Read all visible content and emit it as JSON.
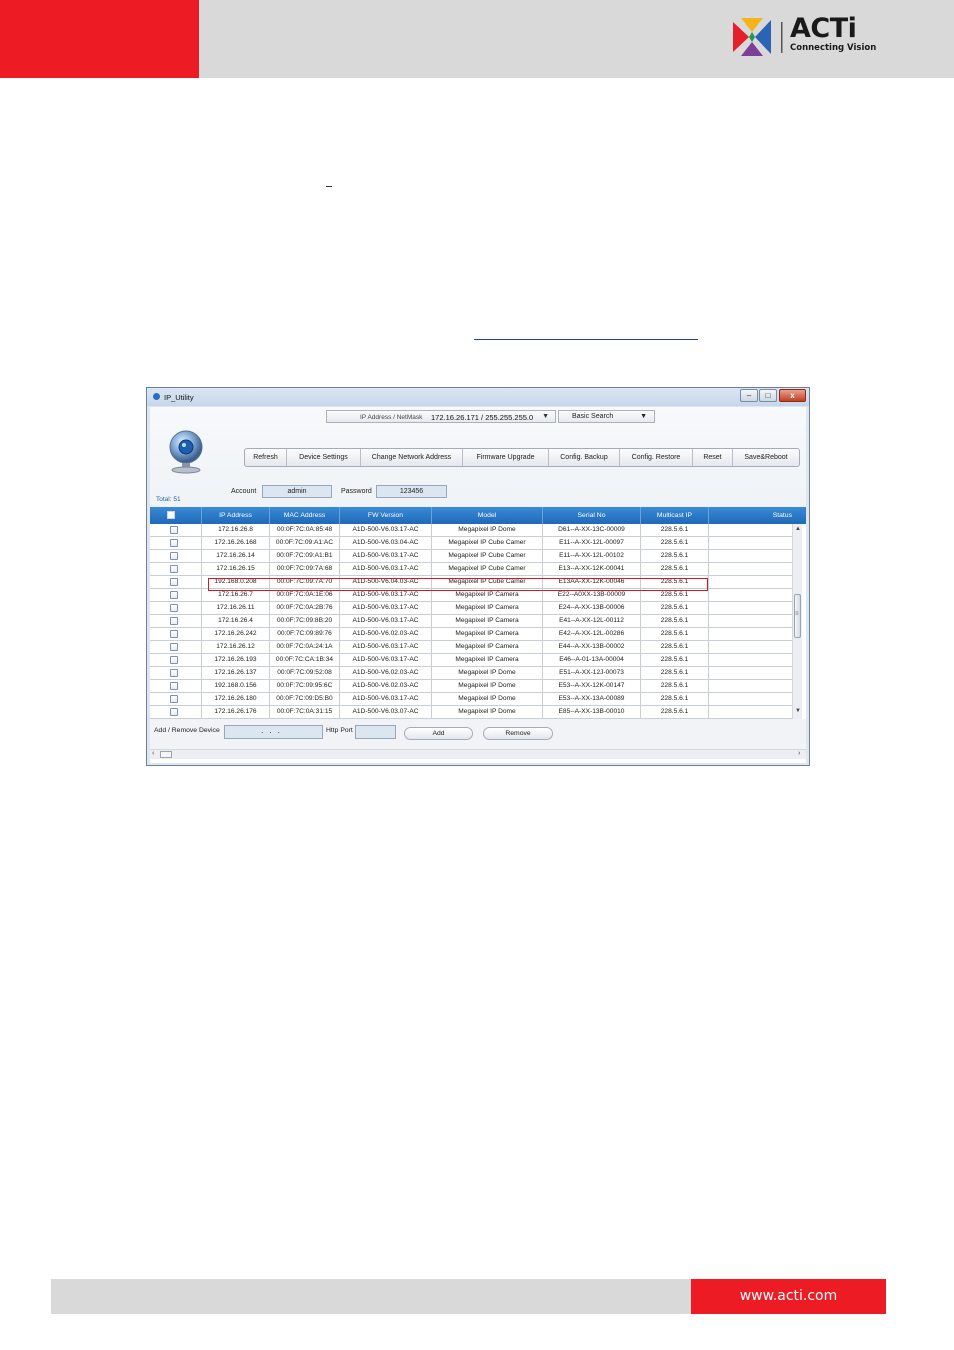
{
  "header": {
    "brand": "ACTi",
    "tagline": "Connecting Vision"
  },
  "footer": {
    "url": "www.acti.com"
  },
  "window": {
    "title": "IP_Utility",
    "minimize_label": "–",
    "maximize_label": "□",
    "close_label": "x",
    "ip_selector_label": "IP Address / NetMask",
    "ip_selector_value": "172.16.26.171 / 255.255.255.0",
    "search_mode": "Basic Search",
    "toolbar": [
      "Refresh",
      "Device Settings",
      "Change Network Address",
      "Firmware Upgrade",
      "Config. Backup",
      "Config. Restore",
      "Reset",
      "Save&Reboot"
    ],
    "account_label": "Account",
    "account_value": "admin",
    "password_label": "Password",
    "password_value": "123456",
    "total": "Total: 51",
    "columns": [
      "IP Address",
      "MAC Address",
      "FW Version",
      "Model",
      "Serial No",
      "Multicast IP",
      "Status"
    ],
    "rows": [
      [
        "172.16.26.8",
        "00:0F:7C:0A:85:48",
        "A1D-500-V6.03.17-AC",
        "Megapixel IP Dome",
        "D61--A-XX-13C-00009",
        "228.5.6.1",
        ""
      ],
      [
        "172.16.26.168",
        "00:0F:7C:09:A1:AC",
        "A1D-500-V6.03.04-AC",
        "Megapixel IP Cube Camer",
        "E11--A-XX-12L-00097",
        "228.5.6.1",
        ""
      ],
      [
        "172.16.26.14",
        "00:0F:7C:09:A1:B1",
        "A1D-500-V6.03.17-AC",
        "Megapixel IP Cube Camer",
        "E11--A-XX-12L-00102",
        "228.5.6.1",
        ""
      ],
      [
        "172.16.26.15",
        "00:0F:7C:09:7A:68",
        "A1D-500-V6.03.17-AC",
        "Megapixel IP Cube Camer",
        "E13--A-XX-12K-00041",
        "228.5.6.1",
        ""
      ],
      [
        "192.168.0.208",
        "00:0F:7C:09:7A:70",
        "A1D-500-V6.04.03-AC",
        "Megapixel IP Cube Camer",
        "E13AA-XX-12K-00046",
        "228.5.6.1",
        ""
      ],
      [
        "172.16.26.7",
        "00:0F:7C:0A:1E:06",
        "A1D-500-V6.03.17-AC",
        "Megapixel IP Camera",
        "E22--A0XX-13B-00009",
        "228.5.6.1",
        ""
      ],
      [
        "172.16.26.11",
        "00:0F:7C:0A:2B:76",
        "A1D-500-V6.03.17-AC",
        "Megapixel IP Camera",
        "E24--A-XX-13B-00006",
        "228.5.6.1",
        ""
      ],
      [
        "172.16.26.4",
        "00:0F:7C:09:8B:20",
        "A1D-500-V6.03.17-AC",
        "Megapixel IP Camera",
        "E41--A-XX-12L-00112",
        "228.5.6.1",
        ""
      ],
      [
        "172.16.26.242",
        "00:0F:7C:09:89:76",
        "A1D-500-V6.02.03-AC",
        "Megapixel IP Camera",
        "E42--A-XX-12L-00286",
        "228.5.6.1",
        ""
      ],
      [
        "172.16.26.12",
        "00:0F:7C:0A:24:1A",
        "A1D-500-V6.03.17-AC",
        "Megapixel IP Camera",
        "E44--A-XX-13B-00002",
        "228.5.6.1",
        ""
      ],
      [
        "172.16.26.193",
        "00:0F:7C:CA:1B:34",
        "A1D-500-V6.03.17-AC",
        "Megapixel IP Camera",
        "E46--A-01-13A-00004",
        "228.5.6.1",
        ""
      ],
      [
        "172.16.26.137",
        "00:0F:7C:09:52:08",
        "A1D-500-V6.02.03-AC",
        "Megapixel IP Dome",
        "E51--A-XX-12J-00073",
        "228.5.6.1",
        ""
      ],
      [
        "192.168.0.156",
        "00:0F:7C:09:95:6C",
        "A1D-500-V6.02.03-AC",
        "Megapixel IP Dome",
        "E53--A-XX-12K-00147",
        "228.5.6.1",
        ""
      ],
      [
        "172.16.26.180",
        "00:0F:7C:09:D5:B0",
        "A1D-500-V6.03.17-AC",
        "Megapixel IP Dome",
        "E53--A-XX-13A-00089",
        "228.5.6.1",
        ""
      ],
      [
        "172.16.26.176",
        "00:0F:7C:0A:31:15",
        "A1D-500-V6.03.07-AC",
        "Megapixel IP Dome",
        "E85--A-XX-13B-00010",
        "228.5.6.1",
        ""
      ]
    ],
    "add_remove_label": "Add / Remove Device",
    "ip_input_value": "...",
    "http_port_label": "Http Port",
    "http_port_value": "",
    "add_button": "Add",
    "remove_button": "Remove",
    "scroll_up": "▲",
    "scroll_down": "▼",
    "scroll_grip": "≡",
    "scroll_left": "‹",
    "scroll_right": "›"
  }
}
